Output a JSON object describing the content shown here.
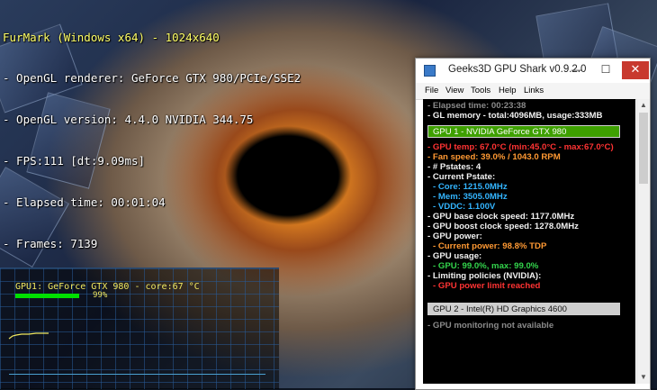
{
  "osd": {
    "title": "FurMark (Windows x64) - 1024x640",
    "lines": [
      "- OpenGL renderer: GeForce GTX 980/PCIe/SSE2",
      "- OpenGL version: 4.4.0 NVIDIA 344.75",
      "- FPS:111 [dt:9.09ms]",
      "- Elapsed time: 00:01:04",
      "- Frames: 7139"
    ]
  },
  "graph": {
    "title": "GPU1: GeForce GTX 980 - core:67 °C",
    "percent": "99%",
    "usage_fraction": 0.99
  },
  "shark": {
    "title": "Geeks3D GPU Shark v0.9.2.0",
    "buttons": {
      "minimize": "—",
      "maximize": "☐",
      "close": "✕"
    },
    "menu": [
      "File",
      "View",
      "Tools",
      "Help",
      "Links"
    ],
    "lines": {
      "elapsed": "- Elapsed time: 00:23:38",
      "gl_memory": "- GL memory - total:4096MB, usage:333MB",
      "gpu1_header": "GPU 1 - NVIDIA GeForce GTX 980",
      "gpu_temp": "- GPU temp: 67.0°C (min:45.0°C - max:67.0°C)",
      "fan_speed": "- Fan speed: 39.0% / 1043.0 RPM",
      "pstates": "- # Pstates: 4",
      "current_pstate": "- Current Pstate:",
      "core": "- Core: 1215.0MHz",
      "mem": "- Mem: 3505.0MHz",
      "vddc": "- VDDC: 1.100V",
      "base_clock": "- GPU base clock speed: 1177.0MHz",
      "boost_clock": "- GPU boost clock speed: 1278.0MHz",
      "gpu_power": "- GPU power:",
      "current_power": "- Current power: 98.8% TDP",
      "gpu_usage": "- GPU usage:",
      "usage_values": "- GPU: 99.0%, max: 99.0%",
      "limiting": "- Limiting policies (NVIDIA):",
      "power_limit": "- GPU power limit reached",
      "gpu2_header": "GPU 2 - Intel(R) HD Graphics 4600",
      "gpu2_monitoring": "- GPU monitoring not available"
    },
    "scroll": {
      "up": "▲",
      "down": "▼"
    }
  },
  "colors": {
    "osd_title": "#ffff66",
    "gpu1_header_bg": "#3ea000",
    "red_text": "#ff3333",
    "orange_text": "#ff9933",
    "blue_text": "#33b5ff",
    "green_text": "#33d44c",
    "close_button": "#c8392e"
  },
  "icons": {
    "app": "gpu-shark-app-icon"
  }
}
